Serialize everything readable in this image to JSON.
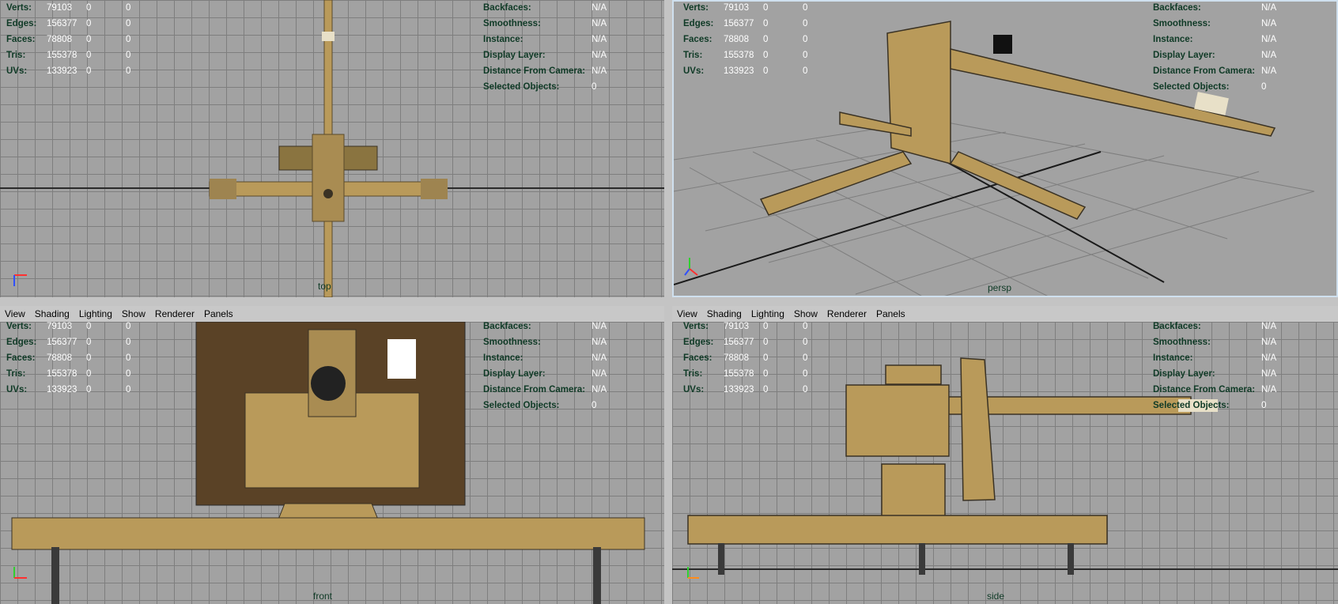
{
  "menu": [
    "View",
    "Shading",
    "Lighting",
    "Show",
    "Renderer",
    "Panels"
  ],
  "stats": {
    "labels": [
      "Verts:",
      "Edges:",
      "Faces:",
      "Tris:",
      "UVs:"
    ],
    "values": [
      [
        "79103",
        "0",
        "0"
      ],
      [
        "156377",
        "0",
        "0"
      ],
      [
        "78808",
        "0",
        "0"
      ],
      [
        "155378",
        "0",
        "0"
      ],
      [
        "133923",
        "0",
        "0"
      ]
    ]
  },
  "info": {
    "labels": [
      "Backfaces:",
      "Smoothness:",
      "Instance:",
      "Display Layer:",
      "Distance From Camera:",
      "Selected Objects:"
    ],
    "values": [
      "N/A",
      "N/A",
      "N/A",
      "N/A",
      "N/A",
      "0"
    ]
  },
  "viewports": {
    "top": {
      "camera": "top"
    },
    "persp": {
      "camera": "persp"
    },
    "front": {
      "camera": "front"
    },
    "side": {
      "camera": "side"
    }
  },
  "axes": {
    "x": "x",
    "y": "y",
    "z": "z"
  },
  "colors": {
    "x_axis": "#ff3030",
    "y_axis": "#30d030",
    "z_axis": "#3050ff",
    "model": "#b99a5a",
    "camo": "#3a3224"
  }
}
